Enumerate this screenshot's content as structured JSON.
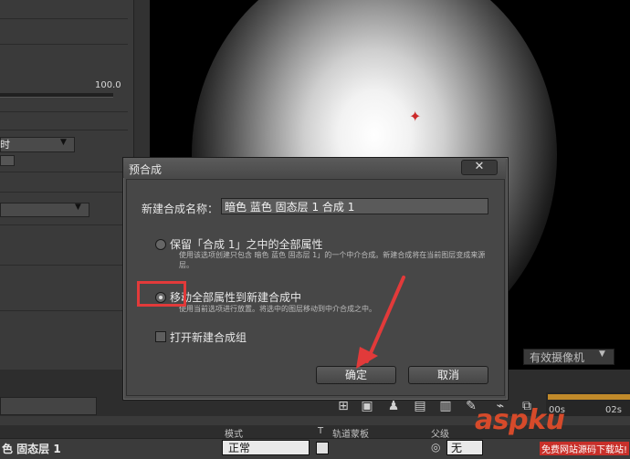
{
  "background": {
    "left_panel": {
      "slider_value": "100.0",
      "dropdown_1_label": "时"
    },
    "viewer": {
      "camera_button": "有效摄像机"
    },
    "timeline": {
      "headers": {
        "mode": "模式",
        "t": "T",
        "track_matte": "轨道蒙板",
        "parent": "父级"
      },
      "layer_name": "色 固态层 1",
      "mode_value": "正常",
      "parent_value": "无",
      "ruler_ticks": [
        "00s",
        "02s"
      ]
    }
  },
  "dialog": {
    "title": "预合成",
    "close_symbol": "✕",
    "name_label": "新建合成名称：",
    "name_value": "暗色 蓝色 固态层 1 合成 1",
    "option_keep": {
      "label": "保留「合成 1」之中的全部属性",
      "description": "使用该选项创建只包含 暗色 蓝色 固态层 1」的一个中介合成。新建合成将在当前图层变成来源层。",
      "selected": false
    },
    "option_move": {
      "label": "移动全部属性到新建合成中",
      "description": "使用当前选项进行放置。将选中的图层移动到中介合成之中。",
      "selected": true
    },
    "open_new_comp": {
      "label": "打开新建合成组",
      "checked": false
    },
    "ok_label": "确定",
    "cancel_label": "取消"
  },
  "annotations": {
    "highlight_color": "#e23a3a",
    "arrow_color": "#e23a3a"
  },
  "watermark": {
    "main": "aspku",
    "sub": "免费网站源码下载站!"
  }
}
